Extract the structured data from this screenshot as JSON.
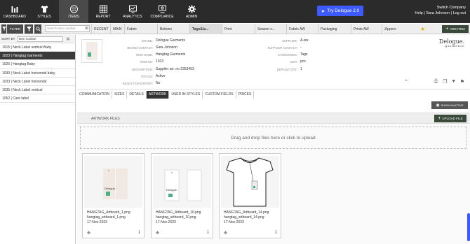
{
  "nav": [
    {
      "label": "DASHBOARD",
      "icon": "bar-chart-icon"
    },
    {
      "label": "STYLES",
      "icon": "shirt-icon"
    },
    {
      "label": "ITEMS",
      "icon": "button-icon"
    },
    {
      "label": "REPORT",
      "icon": "table-icon"
    },
    {
      "label": "ANALYTICS",
      "icon": "analytics-icon"
    },
    {
      "label": "COMPLIANCE",
      "icon": "compliance-icon"
    },
    {
      "label": "ADMIN",
      "icon": "gear-icon"
    }
  ],
  "header": {
    "try_label": "Try Delogue 2.0",
    "company": "Switch Company",
    "user_line": "Help | Sara Johnson | Log out"
  },
  "toolbar": {
    "filter_label": "FILTER",
    "search_placeholder": "Search item number",
    "tabs": [
      "RECENT",
      "MAIN",
      "Fabric",
      "Buttons",
      "Tags&la...",
      "Print",
      "Season c...",
      "Fabric AW",
      "Packaging",
      "Prints AW",
      "Zippers"
    ],
    "add_label": "ADD ITEM"
  },
  "sidebar": {
    "sort_label": "SORT BY",
    "sort_value": "Item number",
    "items": [
      "1015 | Neck Label vertical Baby",
      "1023 | Hangtag Garments",
      "1026 | Hangtag Baby",
      "1030 | Neck Label horisontal baby",
      "1033 | Neck Label horisontal",
      "1035 | Neck Label vertical",
      "1052 | Care label"
    ]
  },
  "detail": {
    "brand_label": "BRAND:",
    "brand": "Delogue Garments",
    "brand_contact_label": "BRAND CONTACT:",
    "brand_contact": "Sara Johnson",
    "item_name_label": "ITEM NAME:",
    "item_name": "Hangtag Garments",
    "item_no_label": "ITEM NO:",
    "item_no": "1023",
    "description_label": "DESCRIPTION:",
    "description": "Supplier art. no 2353453",
    "status_label": "STATUS:",
    "status": "Active",
    "ready_label": "READY FOR EXPORT:",
    "ready": "No",
    "supplier_label": "SUPPLIER:",
    "supplier": "A-tex",
    "supplier_contact_label": "SUPPLIER CONTACT:",
    "supplier_contact": "-",
    "categories_label": "CATEGORIES:",
    "categories": "Tags",
    "unit_label": "UNIT:",
    "unit": "pcs",
    "qty_label": "DEFAULT QTY:",
    "qty": "1",
    "logo_main": "Delogue.",
    "logo_sub": "garments"
  },
  "subtabs": [
    "COMMUNICATION",
    "SIZES",
    "DETAILS",
    "ARTWORK",
    "USED IN STYLES",
    "CUSTOM FIELDS",
    "PRICES"
  ],
  "artwork": {
    "show_inactive": "SHOW INACTIVE",
    "title": "ARTWORK FILES",
    "upload": "UPLOAD FILE",
    "drop": "Drag and drop files here or click to upload",
    "cards": [
      {
        "name": "HANGTAG_Artboard_1.png",
        "file": "hangtag_artboard_1.png",
        "date": "17-Nov-2023"
      },
      {
        "name": "HANGTAG_Artboard_10.png",
        "file": "hangtag_artboard_10.png",
        "date": "17-Nov-2023"
      },
      {
        "name": "HANGTAG_Artboard_14.png",
        "file": "hangtag_artboard_14.png",
        "date": "17-Nov-2023"
      }
    ]
  },
  "colors": {
    "accent": "#3d5afe",
    "dark": "#2b2b2b",
    "tag_green": "#4caf8a"
  }
}
